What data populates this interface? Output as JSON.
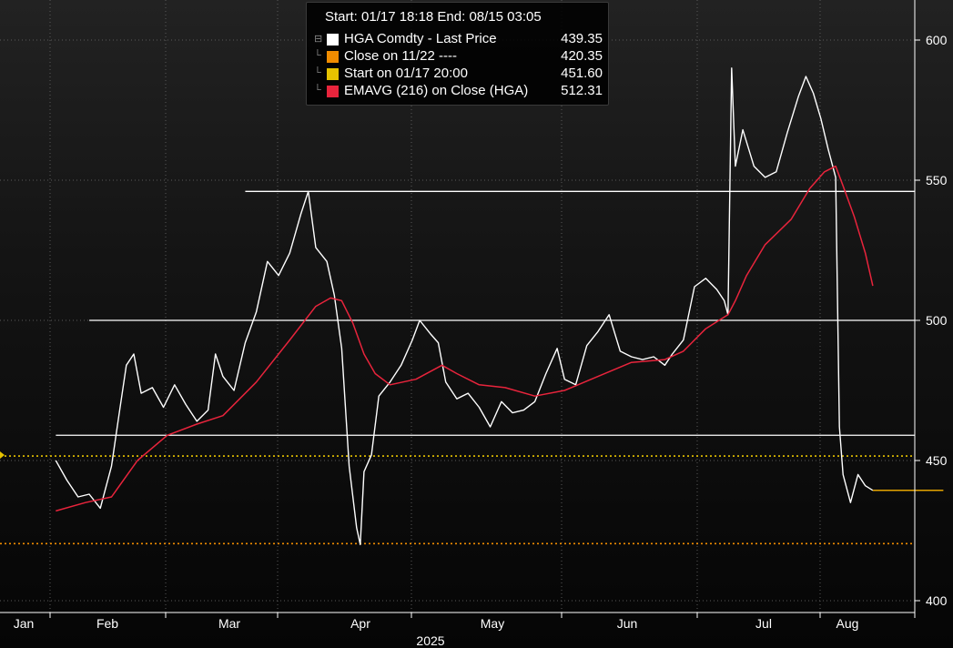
{
  "legend": {
    "header": "Start: 01/17 18:18 End: 08/15 03:05",
    "items": [
      {
        "label": "HGA Comdty - Last Price",
        "value": "439.35",
        "color": "#ffffff"
      },
      {
        "label": "Close on 11/22 ----",
        "value": "420.35",
        "color": "#f08c00"
      },
      {
        "label": "Start on 01/17 20:00",
        "value": "451.60",
        "color": "#e6c200"
      },
      {
        "label": "EMAVG (216)  on Close (HGA)",
        "value": "512.31",
        "color": "#e8243c"
      }
    ]
  },
  "chart_data": {
    "type": "line",
    "xlabel": "2025",
    "ylim": [
      400,
      600
    ],
    "y_ticks": [
      "400",
      "450",
      "500",
      "550",
      "600"
    ],
    "x_ticks": [
      "Jan",
      "Feb",
      "Mar",
      "Apr",
      "May",
      "Jun",
      "Jul",
      "Aug"
    ],
    "grid": true,
    "legend_position": "top-center",
    "reference_lines": [
      {
        "name": "Close on 11/22",
        "value": 420.35,
        "style": "dotted",
        "color": "#f08c00"
      },
      {
        "name": "Start on 01/17 20:00",
        "value": 451.6,
        "style": "dotted",
        "color": "#e6c200"
      }
    ],
    "horizontal_levels": [
      {
        "value": 546,
        "from": "Mar 10",
        "to": "end"
      },
      {
        "value": 500,
        "from": "Jan 27",
        "to": "end"
      },
      {
        "value": 459,
        "from": "Jan 18",
        "to": "end"
      }
    ],
    "series": [
      {
        "name": "HGA Comdty - Last Price",
        "color": "#ffffff",
        "points": [
          [
            "Jan 17",
            450
          ],
          [
            "Jan 20",
            443
          ],
          [
            "Jan 23",
            437
          ],
          [
            "Jan 26",
            438
          ],
          [
            "Jan 29",
            433
          ],
          [
            "Feb 1",
            448
          ],
          [
            "Feb 3",
            466
          ],
          [
            "Feb 5",
            484
          ],
          [
            "Feb 7",
            488
          ],
          [
            "Feb 9",
            474
          ],
          [
            "Feb 12",
            476
          ],
          [
            "Feb 15",
            469
          ],
          [
            "Feb 18",
            477
          ],
          [
            "Feb 21",
            470
          ],
          [
            "Feb 24",
            464
          ],
          [
            "Feb 27",
            468
          ],
          [
            "Mar 1",
            488
          ],
          [
            "Mar 3",
            480
          ],
          [
            "Mar 6",
            475
          ],
          [
            "Mar 9",
            492
          ],
          [
            "Mar 12",
            503
          ],
          [
            "Mar 15",
            521
          ],
          [
            "Mar 18",
            516
          ],
          [
            "Mar 21",
            524
          ],
          [
            "Mar 24",
            538
          ],
          [
            "Mar 26",
            546
          ],
          [
            "Mar 28",
            526
          ],
          [
            "Mar 31",
            521
          ],
          [
            "Apr 2",
            509
          ],
          [
            "Apr 4",
            490
          ],
          [
            "Apr 6",
            448
          ],
          [
            "Apr 8",
            426
          ],
          [
            "Apr 9",
            420
          ],
          [
            "Apr 10",
            446
          ],
          [
            "Apr 12",
            452
          ],
          [
            "Apr 14",
            473
          ],
          [
            "Apr 17",
            478
          ],
          [
            "Apr 20",
            484
          ],
          [
            "Apr 23",
            493
          ],
          [
            "Apr 25",
            500
          ],
          [
            "Apr 28",
            495
          ],
          [
            "Apr 30",
            492
          ],
          [
            "May 2",
            478
          ],
          [
            "May 5",
            472
          ],
          [
            "May 8",
            474
          ],
          [
            "May 11",
            469
          ],
          [
            "May 14",
            462
          ],
          [
            "May 17",
            471
          ],
          [
            "May 20",
            467
          ],
          [
            "May 23",
            468
          ],
          [
            "May 26",
            471
          ],
          [
            "May 29",
            481
          ],
          [
            "Jun 1",
            490
          ],
          [
            "Jun 3",
            479
          ],
          [
            "Jun 6",
            477
          ],
          [
            "Jun 9",
            491
          ],
          [
            "Jun 12",
            496
          ],
          [
            "Jun 15",
            502
          ],
          [
            "Jun 18",
            489
          ],
          [
            "Jun 21",
            487
          ],
          [
            "Jun 24",
            486
          ],
          [
            "Jun 27",
            487
          ],
          [
            "Jun 30",
            484
          ],
          [
            "Jul 2",
            488
          ],
          [
            "Jul 5",
            493
          ],
          [
            "Jul 8",
            512
          ],
          [
            "Jul 11",
            515
          ],
          [
            "Jul 14",
            511
          ],
          [
            "Jul 16",
            507
          ],
          [
            "Jul 17",
            502
          ],
          [
            "Jul 18",
            590
          ],
          [
            "Jul 19",
            555
          ],
          [
            "Jul 21",
            568
          ],
          [
            "Jul 24",
            555
          ],
          [
            "Jul 27",
            551
          ],
          [
            "Jul 30",
            553
          ],
          [
            "Aug 2",
            567
          ],
          [
            "Aug 5",
            580
          ],
          [
            "Aug 7",
            587
          ],
          [
            "Aug 9",
            581
          ],
          [
            "Aug 11",
            572
          ],
          [
            "Aug 13",
            561
          ],
          [
            "Aug 15",
            551
          ],
          [
            "Aug 16",
            462
          ],
          [
            "Aug 17",
            445
          ],
          [
            "Aug 19",
            435
          ],
          [
            "Aug 21",
            445
          ],
          [
            "Aug 23",
            441
          ],
          [
            "Aug 25",
            439.35
          ]
        ]
      },
      {
        "name": "EMAVG (216)  on Close (HGA)",
        "color": "#e8243c",
        "points": [
          [
            "Jan 17",
            432
          ],
          [
            "Jan 25",
            435
          ],
          [
            "Feb 1",
            437
          ],
          [
            "Feb 8",
            450
          ],
          [
            "Feb 16",
            459
          ],
          [
            "Feb 24",
            463
          ],
          [
            "Mar 3",
            466
          ],
          [
            "Mar 12",
            478
          ],
          [
            "Mar 21",
            493
          ],
          [
            "Mar 28",
            505
          ],
          [
            "Apr 1",
            508
          ],
          [
            "Apr 4",
            507
          ],
          [
            "Apr 7",
            499
          ],
          [
            "Apr 10",
            488
          ],
          [
            "Apr 13",
            481
          ],
          [
            "Apr 17",
            477
          ],
          [
            "Apr 24",
            479
          ],
          [
            "May 1",
            484
          ],
          [
            "May 5",
            481
          ],
          [
            "May 11",
            477
          ],
          [
            "May 18",
            476
          ],
          [
            "May 26",
            473
          ],
          [
            "Jun 3",
            475
          ],
          [
            "Jun 12",
            480
          ],
          [
            "Jun 21",
            485
          ],
          [
            "Jun 30",
            486
          ],
          [
            "Jul 5",
            489
          ],
          [
            "Jul 11",
            497
          ],
          [
            "Jul 17",
            502
          ],
          [
            "Jul 19",
            507
          ],
          [
            "Jul 22",
            516
          ],
          [
            "Jul 27",
            527
          ],
          [
            "Aug 3",
            536
          ],
          [
            "Aug 8",
            547
          ],
          [
            "Aug 12",
            553
          ],
          [
            "Aug 15",
            555
          ],
          [
            "Aug 17",
            548
          ],
          [
            "Aug 20",
            537
          ],
          [
            "Aug 23",
            524
          ],
          [
            "Aug 25",
            512.31
          ]
        ]
      },
      {
        "name": "Last Price level",
        "color": "#e6a400",
        "points": [
          [
            "Aug 25",
            439.35
          ],
          [
            "Sep 13",
            439.35
          ]
        ]
      }
    ]
  }
}
